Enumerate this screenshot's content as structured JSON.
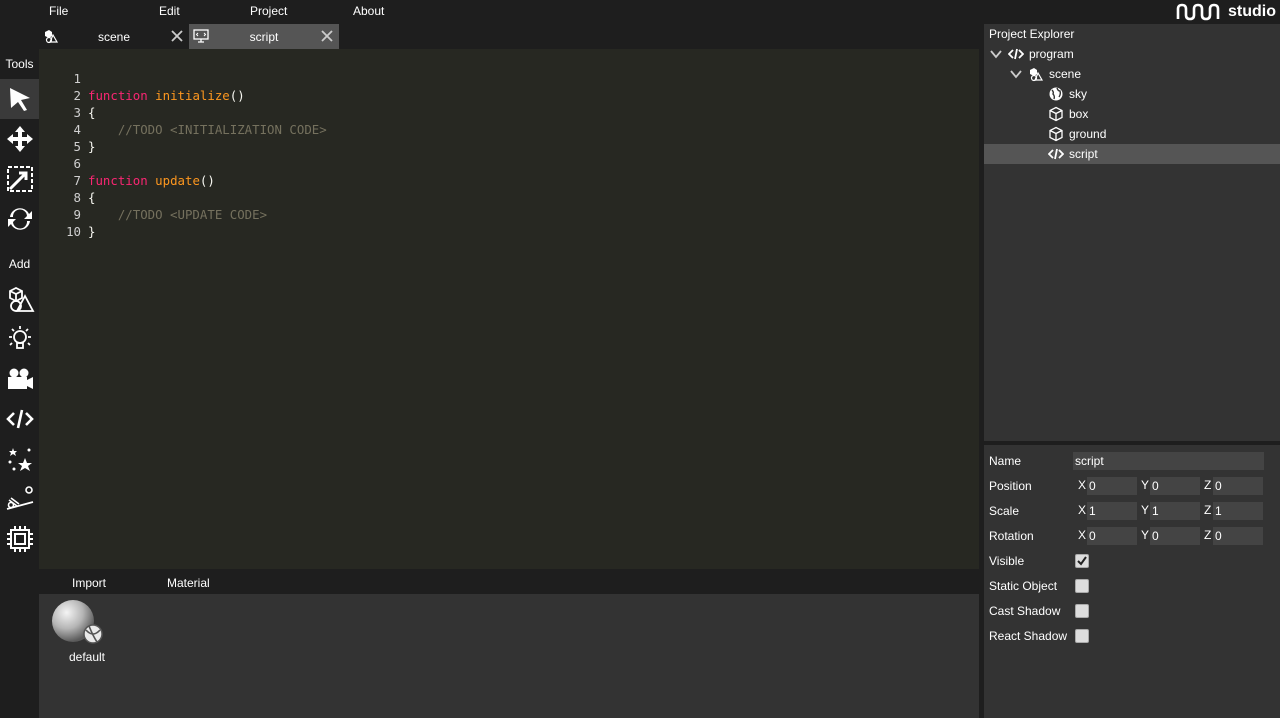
{
  "menu": {
    "file": "File",
    "edit": "Edit",
    "project": "Project",
    "about": "About"
  },
  "logo": {
    "text": "studio"
  },
  "toolbar": {
    "tools_label": "Tools",
    "add_label": "Add",
    "icons": [
      "select-arrow-icon",
      "move-icon",
      "scale-icon",
      "rotate-icon",
      "add-model-icon",
      "add-light-icon",
      "add-camera-icon",
      "add-script-icon",
      "add-effects-icon",
      "add-physics-icon",
      "add-device-icon"
    ]
  },
  "tabs": [
    {
      "label": "scene",
      "icon": "scene-icon",
      "active": false
    },
    {
      "label": "script",
      "icon": "monitor-icon",
      "active": true
    }
  ],
  "editor": {
    "lines": [
      {
        "no": "1",
        "kw": "function",
        "fn": "initialize",
        "rest": "()"
      },
      {
        "no": "2",
        "text": "{"
      },
      {
        "no": "3",
        "comment": "    //TODO <INITIALIZATION CODE>"
      },
      {
        "no": "4",
        "text": "}"
      },
      {
        "no": "5",
        "text": ""
      },
      {
        "no": "6",
        "kw": "function",
        "fn": "update",
        "rest": "()"
      },
      {
        "no": "7",
        "text": "{"
      },
      {
        "no": "8",
        "comment": "    //TODO <UPDATE CODE>"
      },
      {
        "no": "9",
        "text": "}"
      },
      {
        "no": "10",
        "text": ""
      }
    ]
  },
  "assets": {
    "tab_import": "Import",
    "tab_material": "Material",
    "items": [
      {
        "label": "default"
      }
    ]
  },
  "explorer": {
    "title": "Project Explorer",
    "tree": [
      {
        "label": "program",
        "icon": "code-icon",
        "level": 0,
        "expanded": true
      },
      {
        "label": "scene",
        "icon": "scene-icon",
        "level": 1,
        "expanded": true
      },
      {
        "label": "sky",
        "icon": "sky-icon",
        "level": 2
      },
      {
        "label": "box",
        "icon": "cube-icon",
        "level": 2
      },
      {
        "label": "ground",
        "icon": "cube-icon",
        "level": 2
      },
      {
        "label": "script",
        "icon": "code-icon",
        "level": 2,
        "selected": true
      }
    ]
  },
  "properties": {
    "name_label": "Name",
    "name_value": "script",
    "position_label": "Position",
    "position": {
      "x": "0",
      "y": "0",
      "z": "0"
    },
    "scale_label": "Scale",
    "scale": {
      "x": "1",
      "y": "1",
      "z": "1"
    },
    "rotation_label": "Rotation",
    "rotation": {
      "x": "0",
      "y": "0",
      "z": "0"
    },
    "axis_x": "X",
    "axis_y": "Y",
    "axis_z": "Z",
    "visible_label": "Visible",
    "visible": true,
    "static_label": "Static Object",
    "static": false,
    "cast_shadow_label": "Cast Shadow",
    "cast_shadow": false,
    "react_shadow_label": "React Shadow",
    "react_shadow": false
  },
  "colors": {
    "keyword": "#f92672",
    "function": "#fd971f",
    "comment": "#75715e",
    "editor_bg": "#272822",
    "panel_bg": "#333333"
  }
}
